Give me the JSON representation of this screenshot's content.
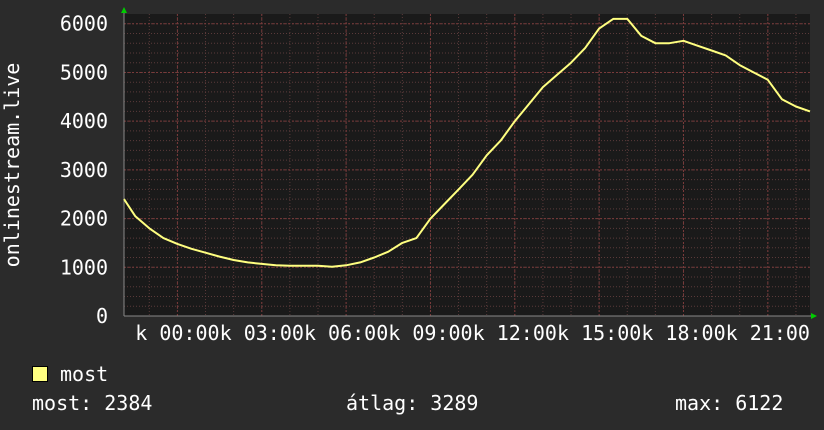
{
  "colors": {
    "background": "#2b2b2b",
    "plot_background": "#1a1a1a",
    "grid": "#5a3a3a",
    "line": "#ffff80",
    "axis_arrow": "#00cc00"
  },
  "chart_data": {
    "type": "line",
    "ylabel": "onlinestream.live",
    "ylim": [
      0,
      6200
    ],
    "yticks": [
      0,
      1000,
      2000,
      3000,
      4000,
      5000,
      6000
    ],
    "xlim": [
      -1.9,
      22.5
    ],
    "xticks": [
      {
        "hour": 0,
        "label": "k 00:00"
      },
      {
        "hour": 3,
        "label": "k 03:00"
      },
      {
        "hour": 6,
        "label": "k 06:00"
      },
      {
        "hour": 9,
        "label": "k 09:00"
      },
      {
        "hour": 12,
        "label": "k 12:00"
      },
      {
        "hour": 15,
        "label": "k 15:00"
      },
      {
        "hour": 18,
        "label": "k 18:00"
      },
      {
        "hour": 21,
        "label": "k 21:00"
      }
    ],
    "grid": true,
    "series": [
      {
        "name": "most",
        "x": [
          -1.9,
          -1.5,
          -1.0,
          -0.5,
          0.0,
          0.5,
          1.0,
          1.5,
          2.0,
          2.5,
          3.0,
          3.5,
          4.0,
          4.5,
          5.0,
          5.5,
          6.0,
          6.5,
          7.0,
          7.5,
          8.0,
          8.5,
          9.0,
          9.5,
          10.0,
          10.5,
          11.0,
          11.5,
          12.0,
          12.5,
          13.0,
          13.5,
          14.0,
          14.5,
          15.0,
          15.5,
          16.0,
          16.5,
          17.0,
          17.5,
          18.0,
          18.5,
          19.0,
          19.5,
          20.0,
          20.5,
          21.0,
          21.5,
          22.0,
          22.5
        ],
        "values": [
          2400,
          2050,
          1800,
          1600,
          1480,
          1380,
          1300,
          1220,
          1150,
          1100,
          1070,
          1040,
          1030,
          1030,
          1030,
          1010,
          1040,
          1100,
          1200,
          1320,
          1500,
          1600,
          2000,
          2300,
          2600,
          2900,
          3300,
          3600,
          4000,
          4350,
          4700,
          4950,
          5200,
          5500,
          5900,
          6100,
          6100,
          5750,
          5600,
          5600,
          5650,
          5550,
          5450,
          5350,
          5150,
          5000,
          4850,
          4450,
          4300,
          4200
        ]
      }
    ]
  },
  "legend": {
    "label": "most"
  },
  "stats": {
    "current": "most: 2384",
    "average": "átlag: 3289",
    "max": "max: 6122"
  }
}
